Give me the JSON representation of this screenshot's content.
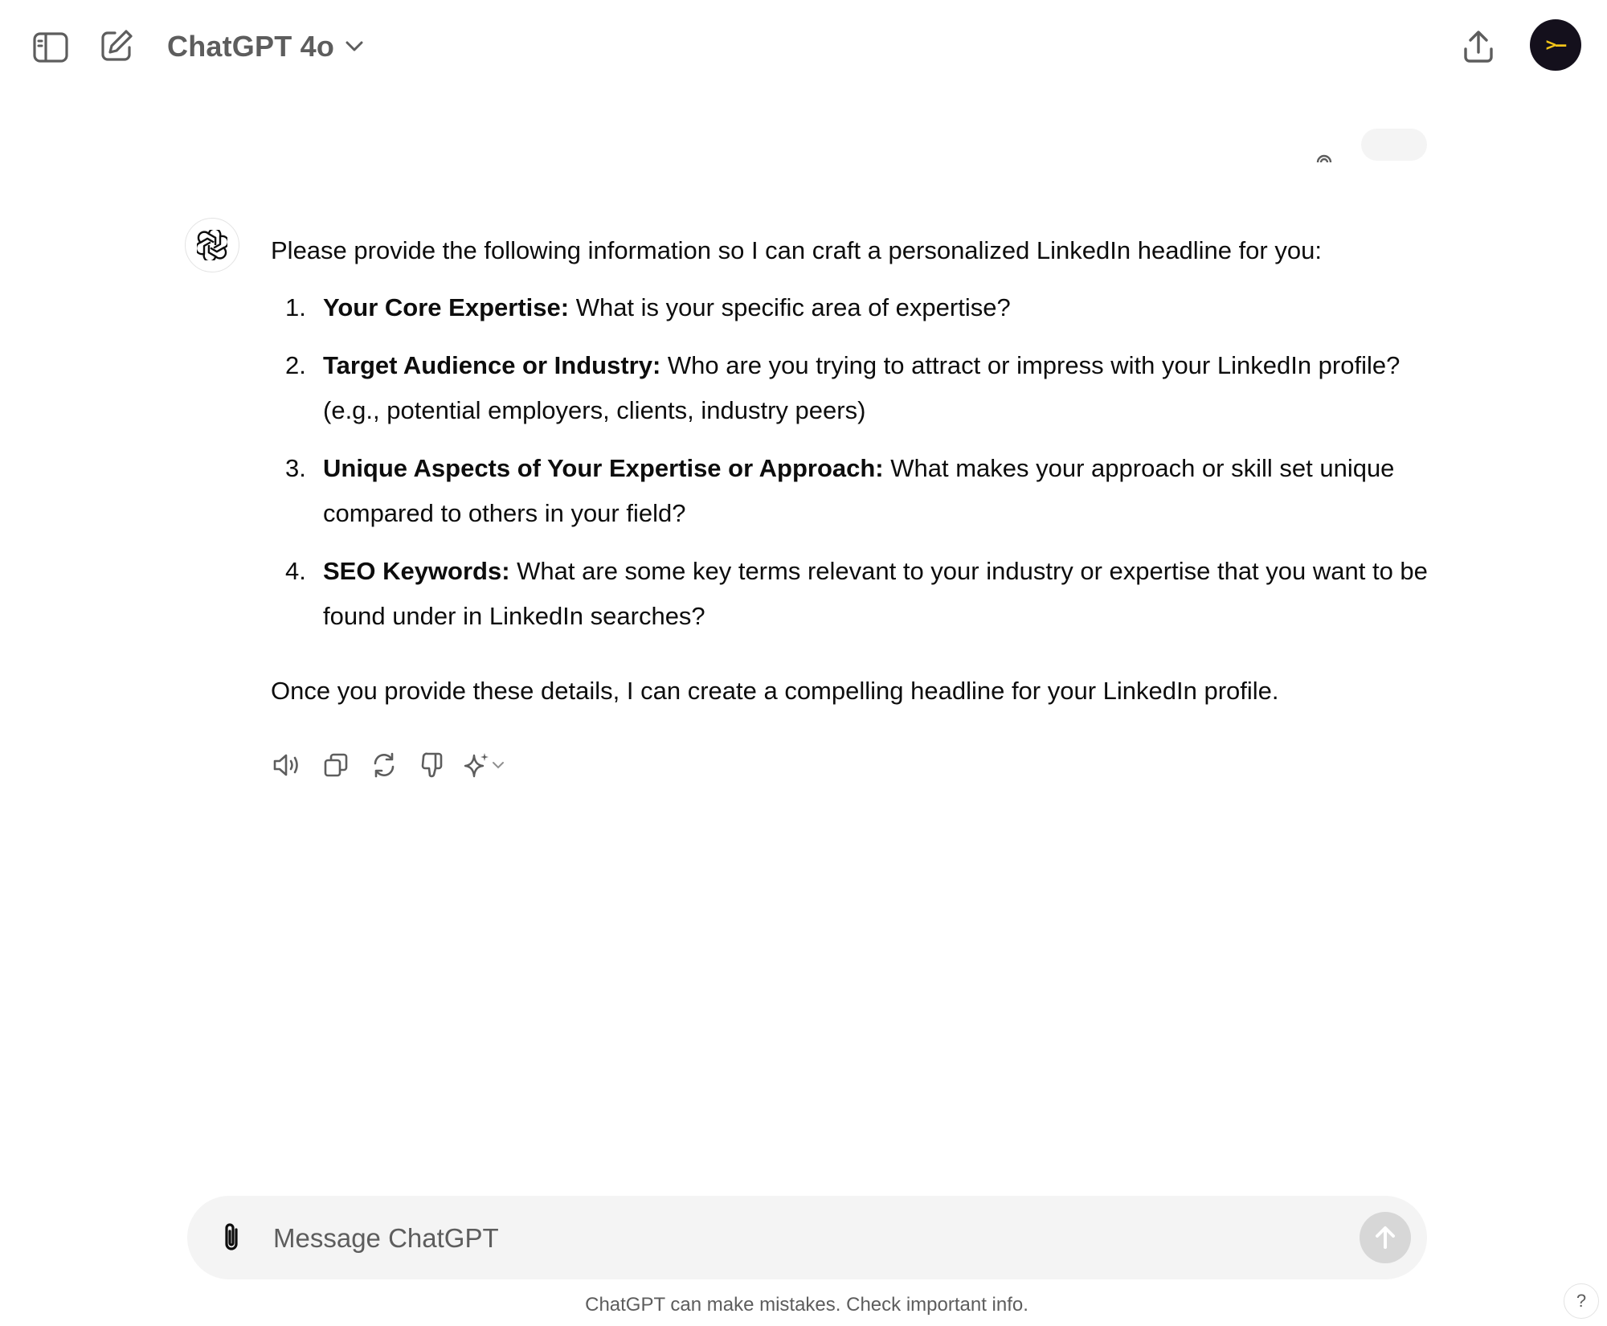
{
  "header": {
    "model_name": "ChatGPT 4o",
    "avatar_glyph": ">–",
    "icons": {
      "sidebar": "sidebar-toggle-icon",
      "new_chat": "new-chat-icon",
      "model_menu": "chevron-down-icon",
      "share": "share-icon"
    }
  },
  "assistant_message": {
    "intro": "Please provide the following information so I can craft a personalized LinkedIn headline for you:",
    "items": [
      {
        "number": "1.",
        "title": "Your Core Expertise:",
        "text": " What is your specific area of expertise?"
      },
      {
        "number": "2.",
        "title": "Target Audience or Industry:",
        "text": " Who are you trying to attract or impress with your LinkedIn profile? (e.g., potential employers, clients, industry peers)"
      },
      {
        "number": "3.",
        "title": "Unique Aspects of Your Expertise or Approach:",
        "text": " What makes your approach or skill set unique compared to others in your field?"
      },
      {
        "number": "4.",
        "title": "SEO Keywords:",
        "text": " What are some key terms relevant to your industry or expertise that you want to be found under in LinkedIn searches?"
      }
    ],
    "outro": "Once you provide these details, I can create a compelling headline for your LinkedIn profile.",
    "actions": [
      "read-aloud-icon",
      "copy-icon",
      "regenerate-icon",
      "thumbs-down-icon",
      "sparkle-icon"
    ]
  },
  "composer": {
    "placeholder": "Message ChatGPT",
    "value": ""
  },
  "footer": {
    "disclaimer": "ChatGPT can make mistakes. Check important info.",
    "help": "?"
  },
  "colors": {
    "background": "#ffffff",
    "text": "#0d0d0d",
    "muted": "#5d5d5d",
    "composer_bg": "#f4f4f4",
    "send_disabled": "#d7d7d7",
    "avatar_bg": "#14101c",
    "avatar_accent": "#f5c518"
  }
}
